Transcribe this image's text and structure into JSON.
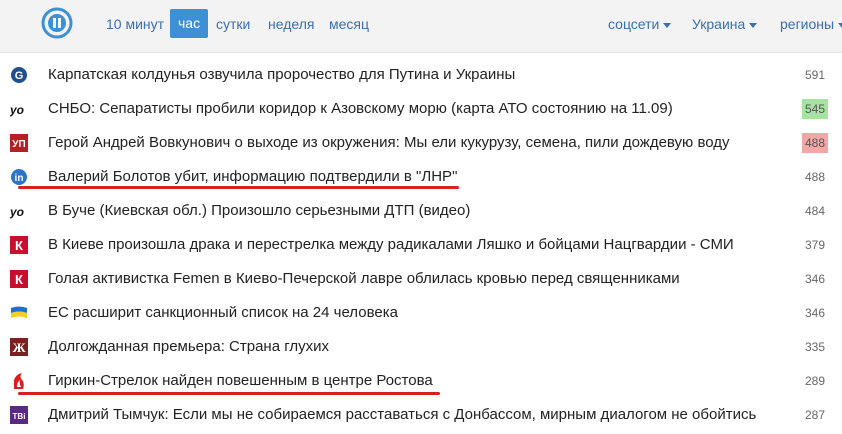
{
  "periods": {
    "p10m": "10 минут",
    "hour": "час",
    "day": "сутки",
    "week": "неделя",
    "month": "месяц"
  },
  "filters": {
    "social": "соцсети",
    "country": "Украина",
    "regions": "регионы"
  },
  "news": [
    {
      "source_icon": "korrespondent-logo-icon",
      "title": "Карпатская колдунья озвучила пророчество для Путина и Украины",
      "count": "591",
      "highlight": "none"
    },
    {
      "source_icon": "uo-logo-icon",
      "title": "СНБО: Сепаратисты пробили коридор к Азовскому морю (карта АТО состоянию на 11.09)",
      "count": "545",
      "highlight": "green"
    },
    {
      "source_icon": "up-logo-icon",
      "title": "Герой Андрей Вовкунович о выходе из окружения: Мы ели кукурузу, семена, пили дождевую воду",
      "count": "488",
      "highlight": "red"
    },
    {
      "source_icon": "tv-logo-icon",
      "title": "Валерий Болотов убит, информацию подтвердили в \"ЛНР\"",
      "count": "488",
      "highlight": "none"
    },
    {
      "source_icon": "uo-logo-icon",
      "title": "В Буче (Киевская обл.) Произошло серьезными ДТП (видео)",
      "count": "484",
      "highlight": "none"
    },
    {
      "source_icon": "k-logo-icon",
      "title": "В Киеве произошла драка и перестрелка между радикалами Ляшко и бойцами Нацгвардии - СМИ",
      "count": "379",
      "highlight": "none"
    },
    {
      "source_icon": "k-logo-icon",
      "title": "Голая активистка Femen в Киево-Печерской лавре облилась кровью перед священниками",
      "count": "346",
      "highlight": "none"
    },
    {
      "source_icon": "ukraine-flag-icon",
      "title": "ЕС расширит санкционный список на 24 человека",
      "count": "346",
      "highlight": "none"
    },
    {
      "source_icon": "zh-logo-icon",
      "title": "Долгожданная премьера: Страна глухих",
      "count": "335",
      "highlight": "none"
    },
    {
      "source_icon": "flame-logo-icon",
      "title": "Гиркин-Стрелок найден повешенным в центре Ростова",
      "count": "289",
      "highlight": "none"
    },
    {
      "source_icon": "tvi-logo-icon",
      "title": "Дмитрий Тымчук: Если мы не собираемся расставаться с Донбассом, мирным диалогом не обойтись",
      "count": "287",
      "highlight": "none"
    }
  ],
  "colors": {
    "accent": "#3d90d6",
    "link": "#3a6fb0",
    "underline": "#d9201e",
    "green_badge": "#a6e3a1",
    "red_badge": "#f2a7a7"
  }
}
